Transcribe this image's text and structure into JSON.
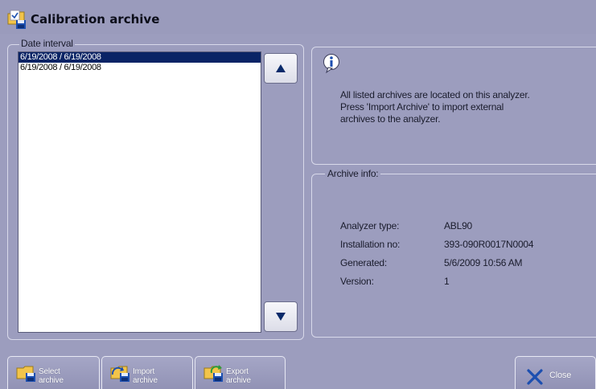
{
  "window": {
    "title": "Calibration archive",
    "icon": "calibration-archive-icon"
  },
  "date_interval": {
    "legend": "Date interval",
    "items": [
      {
        "label": "6/19/2008 / 6/19/2008",
        "selected": true
      },
      {
        "label": "6/19/2008 / 6/19/2008",
        "selected": false
      }
    ],
    "scroll_up_icon": "arrow-up-icon",
    "scroll_down_icon": "arrow-down-icon"
  },
  "info": {
    "icon": "info-icon",
    "line1": "All listed archives are located on this analyzer.",
    "line2": "Press 'Import Archive' to import external",
    "line3": "archives to the analyzer."
  },
  "archive_info": {
    "legend": "Archive info:",
    "rows": [
      {
        "label": "Analyzer type:",
        "value": "ABL90"
      },
      {
        "label": "Installation no:",
        "value": "393-090R0017N0004"
      },
      {
        "label": "Generated:",
        "value": "5/6/2009 10:56 AM"
      },
      {
        "label": "Version:",
        "value": "1"
      }
    ]
  },
  "buttons": {
    "select": {
      "line1": "Select",
      "line2": "archive"
    },
    "import": {
      "line1": "Import",
      "line2": "archive"
    },
    "export": {
      "line1": "Export",
      "line2": "archive"
    },
    "close": {
      "label": "Close"
    }
  },
  "colors": {
    "background": "#9c9dbe",
    "selection": "#0a2466",
    "accent_blue": "#1c4fb0"
  }
}
